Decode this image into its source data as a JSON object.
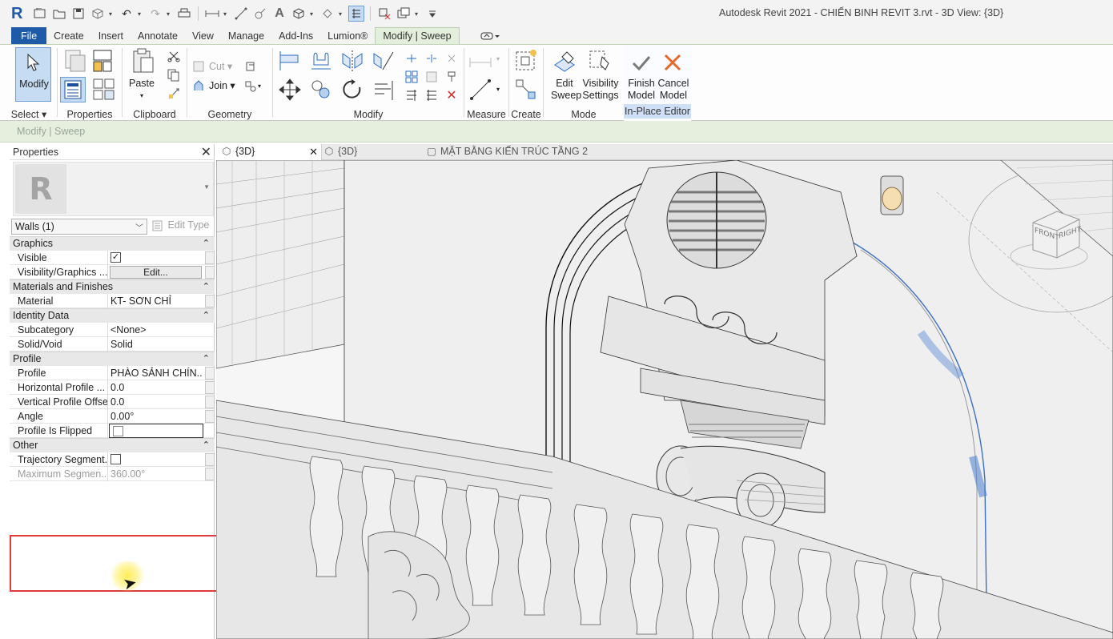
{
  "window": {
    "title": "Autodesk Revit 2021 - CHIẾN BINH REVIT 3.rvt - 3D View: {3D}"
  },
  "quick_access": {
    "logo": "R",
    "icons": [
      "open-icon",
      "folder-icon",
      "save-icon",
      "sync-icon",
      "undo-icon",
      "redo-icon",
      "print-icon",
      "measure-icon",
      "dimension-icon",
      "tag-icon",
      "text-icon",
      "3d-view-icon",
      "section-icon",
      "thin-lines-icon",
      "close-hidden-icon",
      "switch-windows-icon",
      "customize-icon"
    ]
  },
  "ribbon_tabs": [
    "File",
    "Create",
    "Insert",
    "Annotate",
    "View",
    "Manage",
    "Add-Ins",
    "Lumion®",
    "Modify | Sweep"
  ],
  "ribbon_active_tab": "Modify | Sweep",
  "ribbon": {
    "select": {
      "modify_label": "Modify",
      "panel_label": "Select"
    },
    "properties": {
      "panel_label": "Properties"
    },
    "clipboard": {
      "paste_label": "Paste",
      "panel_label": "Clipboard"
    },
    "geometry": {
      "cut_label": "Cut",
      "join_label": "Join",
      "panel_label": "Geometry"
    },
    "modify": {
      "panel_label": "Modify"
    },
    "measure": {
      "panel_label": "Measure"
    },
    "create": {
      "panel_label": "Create"
    },
    "mode": {
      "edit_sweep_line1": "Edit",
      "edit_sweep_line2": "Sweep",
      "visibility_line1": "Visibility",
      "visibility_line2": "Settings",
      "panel_label": "Mode"
    },
    "in_place_editor": {
      "finish_line1": "Finish",
      "finish_line2": "Model",
      "cancel_line1": "Cancel",
      "cancel_line2": "Model",
      "panel_label": "In-Place Editor"
    }
  },
  "options_bar": {
    "context": "Modify | Sweep"
  },
  "properties_palette": {
    "title": "Properties",
    "type_logo": "R",
    "type_selector": "Walls (1)",
    "edit_type_label": "Edit Type",
    "groups": [
      {
        "name": "Graphics",
        "rows": [
          {
            "key": "Visible",
            "value": "☑"
          },
          {
            "key": "Visibility/Graphics ...",
            "value": "Edit..."
          }
        ]
      },
      {
        "name": "Materials and Finishes",
        "rows": [
          {
            "key": "Material",
            "value": "KT- SƠN CHỈ"
          }
        ]
      },
      {
        "name": "Identity Data",
        "rows": [
          {
            "key": "Subcategory",
            "value": "<None>"
          },
          {
            "key": "Solid/Void",
            "value": "Solid"
          }
        ]
      },
      {
        "name": "Profile",
        "rows": [
          {
            "key": "Profile",
            "value": "PHÀO SẢNH CHÍN..."
          },
          {
            "key": "Horizontal Profile ...",
            "value": "0.0"
          },
          {
            "key": "Vertical Profile Offset",
            "value": "0.0"
          },
          {
            "key": "Angle",
            "value": "0.00°"
          },
          {
            "key": "Profile Is Flipped",
            "value": ""
          }
        ]
      },
      {
        "name": "Other",
        "rows": [
          {
            "key": "Trajectory Segment...",
            "value": ""
          },
          {
            "key": "Maximum Segmen...",
            "value": "360.00°"
          }
        ]
      }
    ]
  },
  "view_tabs": [
    {
      "label": "{3D}",
      "active": true
    },
    {
      "label": "{3D}",
      "active": false
    },
    {
      "label": "MẶT BẰNG KIẾN TRÚC TẦNG 2",
      "active": false
    }
  ],
  "viewcube": {
    "front": "FRONT",
    "right": "RIGHT"
  },
  "colors": {
    "file_tab": "#1e5aa8",
    "context_tab": "#e3eedc",
    "highlight_box": "#e03c3c",
    "sweep_blue": "#3d6fc5"
  }
}
